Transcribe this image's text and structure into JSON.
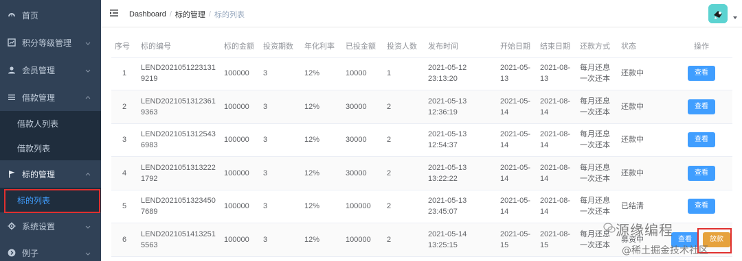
{
  "sidebar": {
    "items": [
      {
        "label": "首页",
        "icon": "dashboard-icon",
        "has_arrow": false
      },
      {
        "label": "积分等级管理",
        "icon": "chart-icon",
        "has_arrow": true
      },
      {
        "label": "会员管理",
        "icon": "user-icon",
        "has_arrow": true
      },
      {
        "label": "借款管理",
        "icon": "list-icon",
        "has_arrow": true,
        "expanded": true
      },
      {
        "label": "标的管理",
        "icon": "flag-icon",
        "has_arrow": true,
        "expanded": true
      },
      {
        "label": "系统设置",
        "icon": "gear-icon",
        "has_arrow": true
      },
      {
        "label": "例子",
        "icon": "circle-arrow-icon",
        "has_arrow": true
      }
    ],
    "loan_sub": [
      "借款人列表",
      "借款列表"
    ],
    "bid_sub": [
      "标的列表"
    ],
    "active_color": "#409eff",
    "background": "#304156",
    "sub_background": "#1f2d3d"
  },
  "header": {
    "breadcrumb": [
      "Dashboard",
      "标的管理",
      "标的列表"
    ]
  },
  "table": {
    "headers": [
      "序号",
      "标的编号",
      "标的金额",
      "投资期数",
      "年化利率",
      "已投金额",
      "投资人数",
      "发布时间",
      "开始日期",
      "结束日期",
      "还款方式",
      "状态",
      "操作"
    ],
    "rows": [
      {
        "no": "1",
        "code1": "LEND2021051223131",
        "code2": "9219",
        "amount": "100000",
        "periods": "3",
        "rate": "12%",
        "invested": "10000",
        "investors": "1",
        "published": "2021-05-12 23:13:20",
        "start1": "2021-05-",
        "start2": "13",
        "end1": "2021-08-",
        "end2": "13",
        "repay1": "每月还息",
        "repay2": "一次还本",
        "status": "还款中",
        "btn": "查看"
      },
      {
        "no": "2",
        "code1": "LEND2021051312361",
        "code2": "9363",
        "amount": "100000",
        "periods": "3",
        "rate": "12%",
        "invested": "30000",
        "investors": "2",
        "published": "2021-05-13 12:36:19",
        "start1": "2021-05-",
        "start2": "14",
        "end1": "2021-08-",
        "end2": "14",
        "repay1": "每月还息",
        "repay2": "一次还本",
        "status": "还款中",
        "btn": "查看"
      },
      {
        "no": "3",
        "code1": "LEND2021051312543",
        "code2": "6983",
        "amount": "100000",
        "periods": "3",
        "rate": "12%",
        "invested": "30000",
        "investors": "2",
        "published": "2021-05-13 12:54:37",
        "start1": "2021-05-",
        "start2": "14",
        "end1": "2021-08-",
        "end2": "14",
        "repay1": "每月还息",
        "repay2": "一次还本",
        "status": "还款中",
        "btn": "查看"
      },
      {
        "no": "4",
        "code1": "LEND2021051313222",
        "code2": "1792",
        "amount": "100000",
        "periods": "3",
        "rate": "12%",
        "invested": "30000",
        "investors": "2",
        "published": "2021-05-13 13:22:22",
        "start1": "2021-05-",
        "start2": "14",
        "end1": "2021-08-",
        "end2": "14",
        "repay1": "每月还息",
        "repay2": "一次还本",
        "status": "还款中",
        "btn": "查看"
      },
      {
        "no": "5",
        "code1": "LEND2021051323450",
        "code2": "7689",
        "amount": "100000",
        "periods": "3",
        "rate": "12%",
        "invested": "100000",
        "investors": "2",
        "published": "2021-05-13 23:45:07",
        "start1": "2021-05-",
        "start2": "14",
        "end1": "2021-08-",
        "end2": "14",
        "repay1": "每月还息",
        "repay2": "一次还本",
        "status": "已结清",
        "btn": "查看"
      },
      {
        "no": "6",
        "code1": "LEND2021051413251",
        "code2": "5563",
        "amount": "100000",
        "periods": "3",
        "rate": "12%",
        "invested": "100000",
        "investors": "2",
        "published": "2021-05-14 13:25:15",
        "start1": "2021-05-",
        "start2": "15",
        "end1": "2021-08-",
        "end2": "15",
        "repay1": "每月还息",
        "repay2": "一次还本",
        "status": "募资中",
        "btn": "查看",
        "btn2": "放款"
      }
    ]
  },
  "watermark": {
    "line1": "源缘编程",
    "line2": "@稀土掘金技术社区"
  },
  "colors": {
    "primary": "#409eff",
    "warning": "#e6a23c",
    "highlight_border": "#e0302f"
  }
}
